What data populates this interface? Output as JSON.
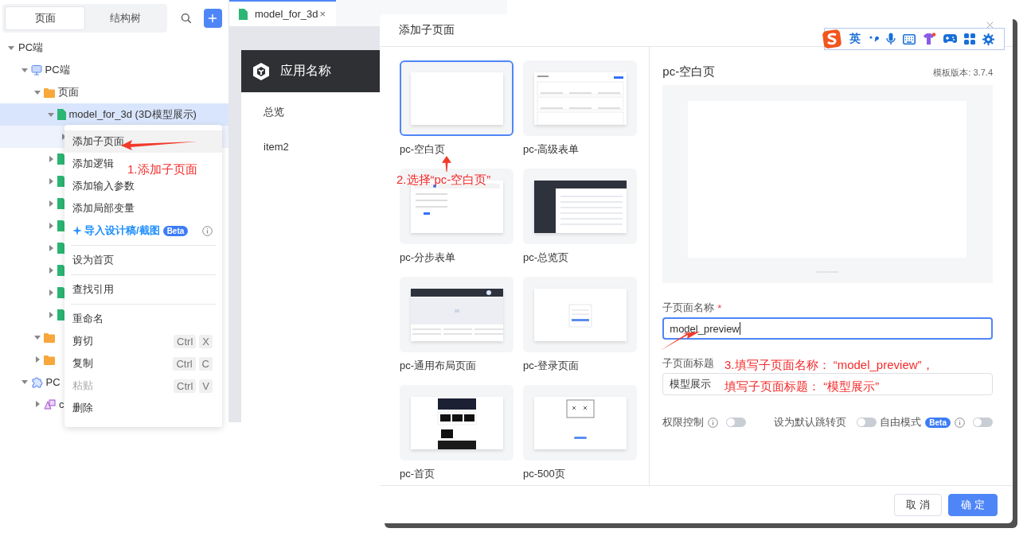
{
  "sidebar": {
    "tabs": [
      {
        "label": "页面",
        "selected": true
      },
      {
        "label": "结构树",
        "selected": false
      }
    ],
    "tree": [
      {
        "label": "PC端",
        "expanded": true,
        "selected": false,
        "hovered": false,
        "children": [
          {
            "label": "PC端",
            "kind": "monitor",
            "expanded": true,
            "selected": false,
            "hovered": false,
            "children": [
              {
                "label": "页面",
                "kind": "folder",
                "expanded": true,
                "selected": false,
                "hovered": false,
                "children": [
                  {
                    "label": "model_for_3d (3D模型展示)",
                    "kind": "page",
                    "expanded": true,
                    "selected": true,
                    "hovered": false,
                    "children": [
                      {
                        "expanded": false,
                        "selected": false,
                        "hovered": true
                      }
                    ]
                  },
                  {
                    "kind": "page",
                    "expanded": false,
                    "selected": false,
                    "hovered": false
                  },
                  {
                    "kind": "page",
                    "expanded": false,
                    "selected": false,
                    "hovered": false
                  },
                  {
                    "kind": "page",
                    "expanded": false,
                    "selected": false,
                    "hovered": false
                  },
                  {
                    "kind": "page",
                    "expanded": false,
                    "selected": false,
                    "hovered": false
                  },
                  {
                    "kind": "page",
                    "expanded": false,
                    "selected": false,
                    "hovered": false
                  },
                  {
                    "kind": "page",
                    "expanded": false,
                    "selected": false,
                    "hovered": false
                  },
                  {
                    "kind": "page",
                    "expanded": false,
                    "selected": false,
                    "hovered": false
                  },
                  {
                    "kind": "page",
                    "expanded": false,
                    "selected": false,
                    "hovered": false
                  }
                ]
              },
              {
                "kind": "folder",
                "expanded": true,
                "selected": false,
                "hovered": false
              },
              {
                "kind": "folder",
                "expanded": false,
                "selected": false,
                "hovered": false
              }
            ]
          },
          {
            "label": "PC",
            "kind": "puzzle",
            "expanded": true,
            "selected": false,
            "hovered": false,
            "children": [
              {
                "label": "c",
                "kind": "component",
                "expanded": false,
                "selected": false,
                "hovered": false
              }
            ]
          }
        ]
      }
    ]
  },
  "editor": {
    "tab": {
      "label": "model_for_3d",
      "close": "×"
    },
    "app_name": "应用名称",
    "menu": [
      "总览",
      "item2"
    ]
  },
  "context_menu": {
    "groups": [
      [
        {
          "kind": "action",
          "label": "添加子页面",
          "hovered": true,
          "disabled": false
        },
        {
          "kind": "action",
          "label": "添加逻辑",
          "hovered": false,
          "disabled": false
        },
        {
          "kind": "action",
          "label": "添加输入参数",
          "hovered": false,
          "disabled": false
        },
        {
          "kind": "action",
          "label": "添加局部变量",
          "hovered": false,
          "disabled": false
        },
        {
          "kind": "ai",
          "label": "导入设计稿/截图",
          "badge": "Beta",
          "hovered": false,
          "disabled": false
        }
      ],
      [
        {
          "kind": "action",
          "label": "设为首页",
          "hovered": false,
          "disabled": false
        }
      ],
      [
        {
          "kind": "action",
          "label": "查找引用",
          "hovered": false,
          "disabled": false
        }
      ],
      [
        {
          "kind": "action",
          "label": "重命名",
          "hovered": false,
          "disabled": false
        },
        {
          "kind": "action",
          "label": "剪切",
          "keys": [
            "Ctrl",
            "X"
          ],
          "hovered": false,
          "disabled": false
        },
        {
          "kind": "action",
          "label": "复制",
          "keys": [
            "Ctrl",
            "C"
          ],
          "hovered": false,
          "disabled": false
        },
        {
          "kind": "action",
          "label": "粘贴",
          "keys": [
            "Ctrl",
            "V"
          ],
          "hovered": false,
          "disabled": true
        },
        {
          "kind": "action",
          "label": "删除",
          "hovered": false,
          "disabled": false
        }
      ]
    ]
  },
  "dialog": {
    "title": "添加子页面",
    "templates": [
      {
        "name": "pc-空白页",
        "kind": "blank",
        "selected": true
      },
      {
        "name": "pc-高级表单",
        "kind": "form",
        "selected": false
      },
      {
        "name": "pc-分步表单",
        "kind": "steps",
        "selected": false
      },
      {
        "name": "pc-总览页",
        "kind": "overview",
        "selected": false
      },
      {
        "name": "pc-通用布局页面",
        "kind": "layout",
        "selected": false
      },
      {
        "name": "pc-登录页面",
        "kind": "login",
        "selected": false
      },
      {
        "name": "pc-首页",
        "kind": "home",
        "selected": false
      },
      {
        "name": "pc-500页",
        "kind": "error",
        "selected": false
      }
    ],
    "preview": {
      "title": "pc-空白页",
      "version": "模板版本: 3.7.4"
    },
    "fields": [
      {
        "label": "子页面名称",
        "required_mark": "*",
        "value": "model_preview",
        "focused": true
      },
      {
        "label": "子页面标题",
        "value": "模型展示",
        "focused": false
      }
    ],
    "toggles": [
      {
        "label": "权限控制",
        "info": true,
        "on": false
      },
      {
        "label": "设为默认跳转页",
        "info": false,
        "on": false
      },
      {
        "label": "自由模式",
        "badge": "Beta",
        "info": true,
        "on": false
      }
    ],
    "buttons": [
      {
        "label": "取 消",
        "kind": "secondary"
      },
      {
        "label": "确 定",
        "kind": "primary"
      }
    ]
  },
  "ime_toolbar": {
    "mode": "英"
  },
  "annotations": [
    {
      "lines": [
        "1.添加子页面"
      ]
    },
    {
      "lines": [
        "2.选择“pc-空白页”"
      ]
    },
    {
      "lines": [
        "3.填写子页面名称：  “model_preview”，",
        "填写子页面标题：  “模型展示”"
      ]
    }
  ]
}
